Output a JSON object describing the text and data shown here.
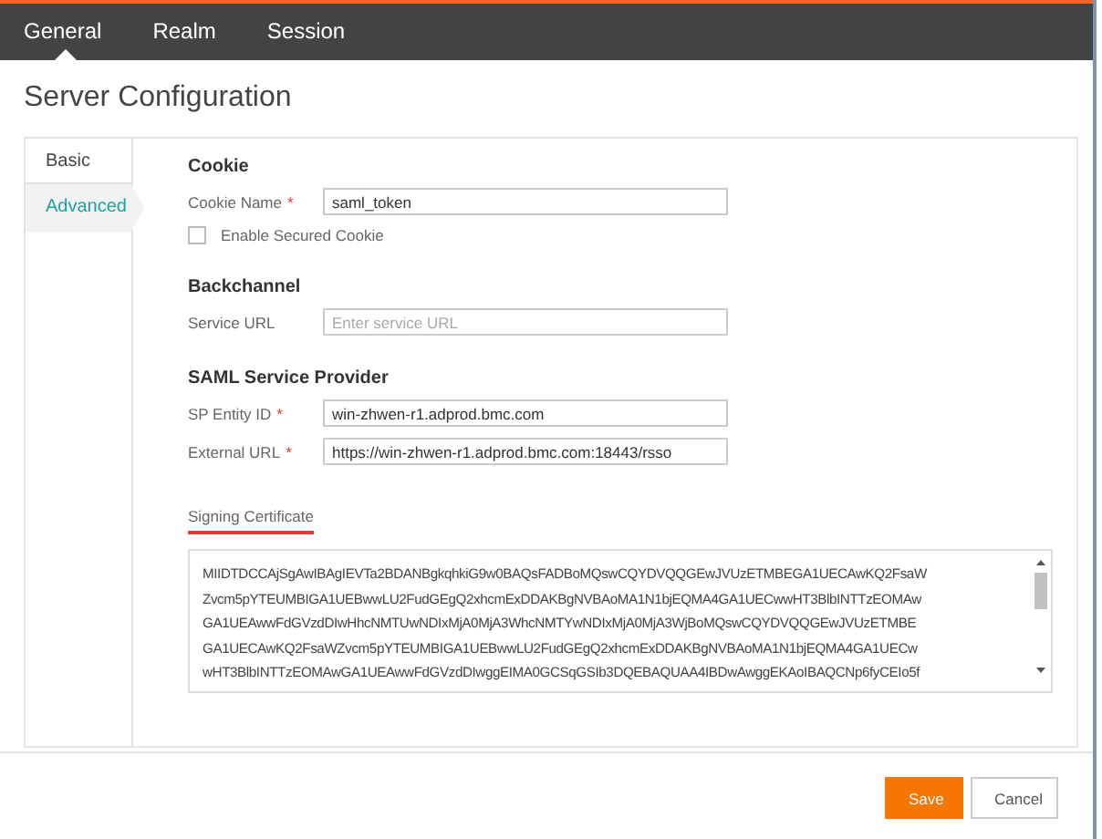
{
  "top_tabs": [
    {
      "label": "General",
      "selected": true
    },
    {
      "label": "Realm",
      "selected": false
    },
    {
      "label": "Session",
      "selected": false
    }
  ],
  "page_title": "Server Configuration",
  "side_tabs": [
    {
      "label": "Basic",
      "selected": false
    },
    {
      "label": "Advanced",
      "selected": true
    }
  ],
  "sections": [
    {
      "heading": "Cookie",
      "items": [
        {
          "kind": "field",
          "label": "Cookie Name",
          "required_mark": "*",
          "value": "saml_token"
        },
        {
          "kind": "checkbox",
          "label": "Enable Secured Cookie",
          "checked": false
        }
      ]
    },
    {
      "heading": "Backchannel",
      "items": [
        {
          "kind": "field",
          "label": "Service URL",
          "placeholder": "Enter service URL"
        }
      ]
    },
    {
      "heading": "SAML Service Provider",
      "items": [
        {
          "kind": "field",
          "label": "SP Entity ID",
          "required_mark": "*",
          "value": "win-zhwen-r1.adprod.bmc.com"
        },
        {
          "kind": "field",
          "label": "External URL",
          "required_mark": "*",
          "value": "https://win-zhwen-r1.adprod.bmc.com:18443/rsso"
        }
      ]
    }
  ],
  "certificate": {
    "label": "Signing Certificate",
    "lines": [
      "MIIDTDCCAjSgAwIBAgIEVTa2BDANBgkqhkiG9w0BAQsFADBoMQswCQYDVQQGEwJVUzETMBEGA1UECAwKQ2FsaW",
      "Zvcm5pYTEUMBIGA1UEBwwLU2FudGEgQ2xhcmExDDAKBgNVBAoMA1N1bjEQMA4GA1UECwwHT3BlbINTTzEOMAw",
      "GA1UEAwwFdGVzdDIwHhcNMTUwNDIxMjA0MjA3WhcNMTYwNDIxMjA0MjA3WjBoMQswCQYDVQQGEwJVUzETMBE",
      "GA1UECAwKQ2FsaWZvcm5pYTEUMBIGA1UEBwwLU2FudGEgQ2xhcmExDDAKBgNVBAoMA1N1bjEQMA4GA1UECw",
      "wHT3BlbINTTzEOMAwGA1UEAwwFdGVzdDIwggEIMA0GCSqGSIb3DQEBAQUAA4IBDwAwggEKAoIBAQCNp6fyCEIo5f"
    ]
  },
  "buttons": [
    {
      "kind": "primary",
      "label": "Save"
    },
    {
      "kind": "secondary",
      "label": "Cancel"
    }
  ]
}
